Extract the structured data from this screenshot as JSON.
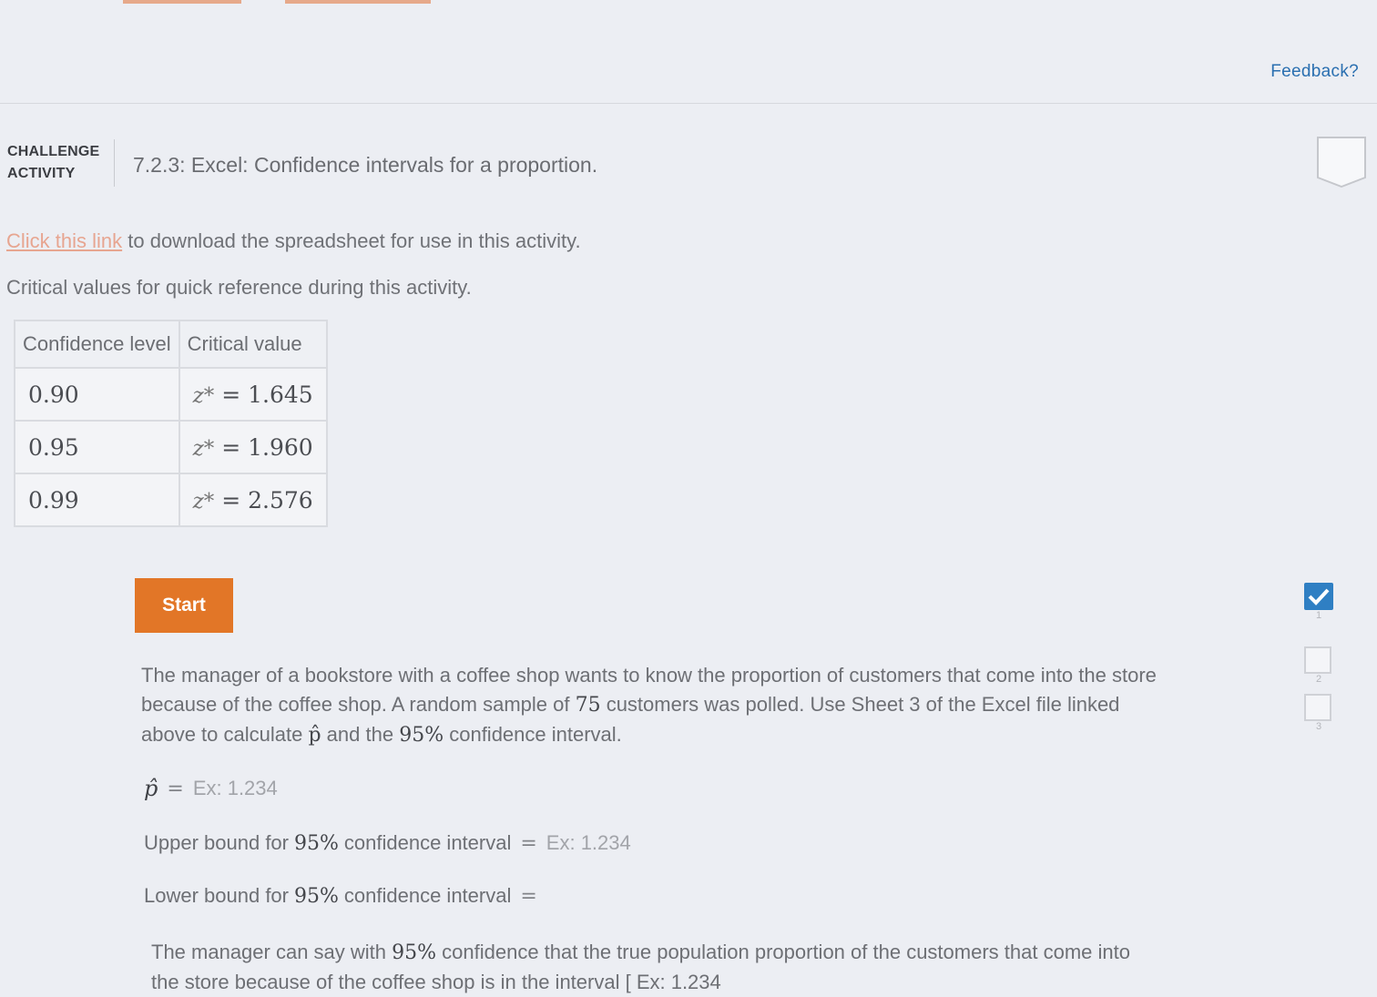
{
  "header": {
    "feedback_label": "Feedback?"
  },
  "activity": {
    "label_line1": "CHALLENGE",
    "label_line2": "ACTIVITY",
    "title": "7.2.3: Excel: Confidence intervals for a proportion."
  },
  "intro": {
    "link_text": "Click this link",
    "link_rest": " to download the spreadsheet for use in this activity.",
    "critical_text": "Critical values for quick reference during this activity."
  },
  "critical_table": {
    "headers": [
      "Confidence level",
      "Critical value"
    ],
    "rows": [
      {
        "level": "0.90",
        "z_symbol": "z*",
        "value": "= 1.645"
      },
      {
        "level": "0.95",
        "z_symbol": "z*",
        "value": "= 1.960"
      },
      {
        "level": "0.99",
        "z_symbol": "z*",
        "value": "= 2.576"
      }
    ]
  },
  "start_button": "Start",
  "problem": {
    "part1": "The manager of a bookstore with a coffee shop wants to know the proportion of customers that come into the store because of the coffee shop. A random sample of ",
    "n": "75",
    "part2": " customers was polled. Use Sheet 3 of the Excel file linked above to calculate ",
    "phat": "p̂",
    "part3": " and the ",
    "pct": "95%",
    "part4": " confidence interval."
  },
  "answers": {
    "phat_symbol": "p̂",
    "eq": "=",
    "phat_placeholder": "Ex: 1.234",
    "upper_prefix": "Upper bound for ",
    "upper_pct": "95%",
    "upper_suffix": " confidence interval",
    "upper_placeholder": "Ex: 1.234",
    "lower_prefix": "Lower bound for ",
    "lower_pct": "95%",
    "lower_suffix": " confidence interval"
  },
  "conclusion": {
    "part1": "The manager can say with ",
    "pct": "95%",
    "part2": " confidence that the true population proportion of the customers that come into the store because of the coffee shop is in the interval [ Ex: 1.234"
  },
  "levels": [
    {
      "num": "1",
      "done": true
    },
    {
      "num": "2",
      "done": false
    },
    {
      "num": "3",
      "done": false
    }
  ],
  "colors": {
    "accent_button": "#e27627",
    "link": "#e7a590",
    "feedback": "#2a6fb0",
    "check": "#2f7fc3"
  }
}
